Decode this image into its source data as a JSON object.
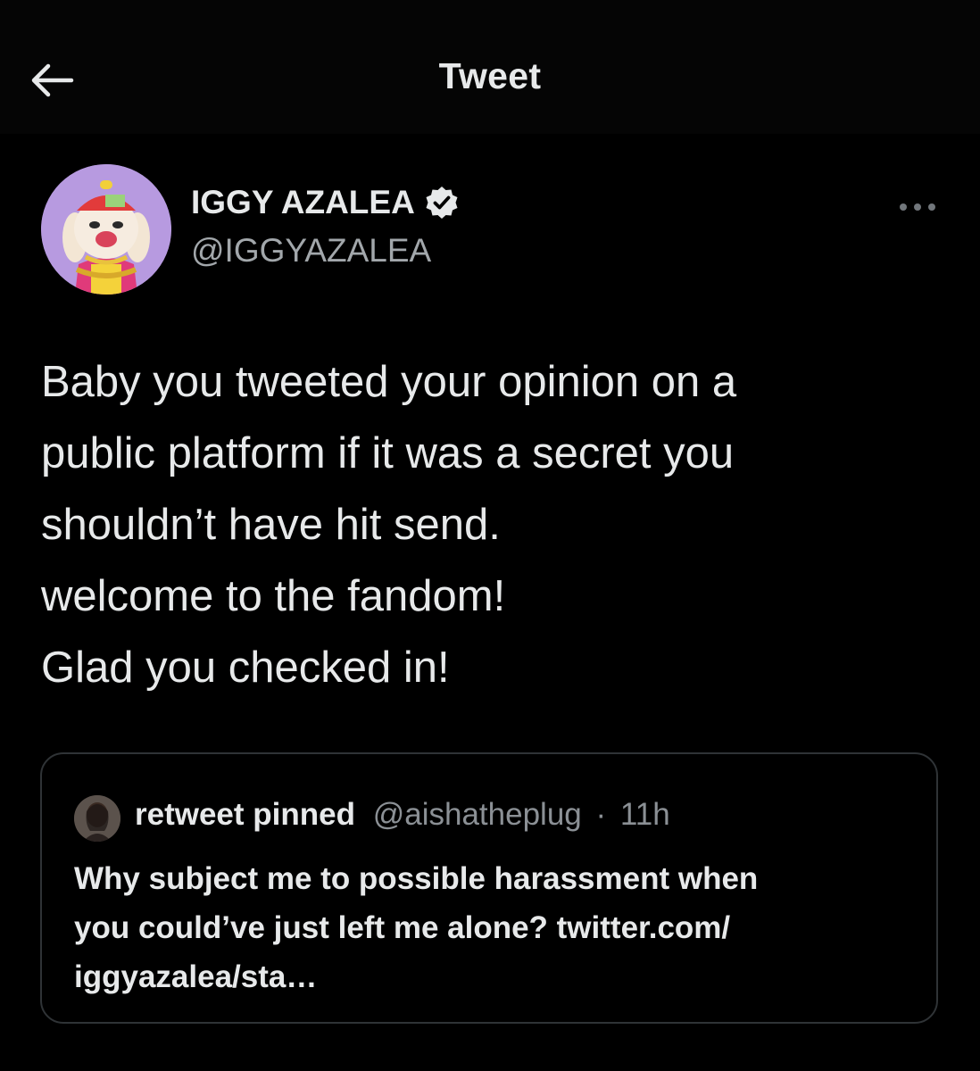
{
  "header": {
    "title": "Tweet",
    "back_icon": "arrow-left-icon"
  },
  "author": {
    "display_name": "IGGY AZALEA",
    "handle": "@IGGYAZALEA",
    "verified_icon": "verified-badge-icon",
    "avatar_bg": "#b79ae0"
  },
  "more_icon": "more-horizontal-icon",
  "tweet": {
    "lines": [
      "Baby you tweeted your opinion on a",
      "public platform if it was a secret you",
      "shouldn’t have hit send.",
      "welcome to the fandom!",
      "Glad you checked in!"
    ]
  },
  "quoted": {
    "display_name": "retweet pinned",
    "handle": "@aishatheplug",
    "separator": "·",
    "time": "11h",
    "lines": [
      "Why subject me to possible harassment when",
      "you could’ve just left me alone? twitter.com/",
      "iggyazalea/sta…"
    ]
  },
  "colors": {
    "background": "#000000",
    "text_primary": "#e7e9ea",
    "text_secondary": "#8b9095",
    "border": "#2f3336"
  }
}
